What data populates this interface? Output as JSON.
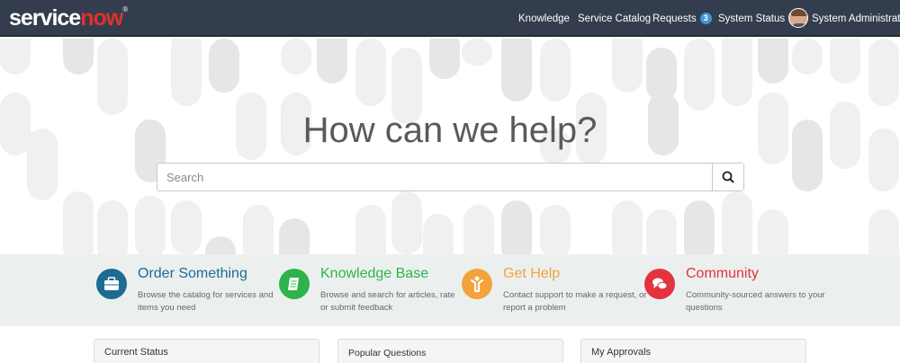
{
  "header": {
    "logo_service": "service",
    "logo_now": "now",
    "logo_mark": "®",
    "nav": {
      "knowledge": "Knowledge",
      "service_catalog": "Service Catalog",
      "requests": "Requests",
      "requests_count": "3",
      "system_status": "System Status",
      "user_name": "System Administrator"
    }
  },
  "hero": {
    "title": "How can we help?",
    "search_placeholder": "Search"
  },
  "quick_links": [
    {
      "title": "Order Something",
      "description": "Browse the catalog for services and items you need",
      "color": "#1d6b93",
      "icon": "briefcase-icon"
    },
    {
      "title": "Knowledge Base",
      "description": "Browse and search for articles, rate or submit feedback",
      "color": "#2eb34a",
      "icon": "book-icon"
    },
    {
      "title": "Get Help",
      "description": "Contact support to make a request, or report a problem",
      "color": "#f2a33a",
      "icon": "person-help-icon"
    },
    {
      "title": "Community",
      "description": "Community-sourced answers to your questions",
      "color": "#e2333f",
      "icon": "chat-bubbles-icon"
    }
  ],
  "panels": {
    "current_status": "Current Status",
    "popular_questions": "Popular Questions",
    "my_approvals": "My Approvals"
  },
  "colors": {
    "header_bg": "#343d4e",
    "band_bg": "#ebf0ef",
    "badge": "#3b97d9",
    "logo_accent": "#e0322b"
  }
}
